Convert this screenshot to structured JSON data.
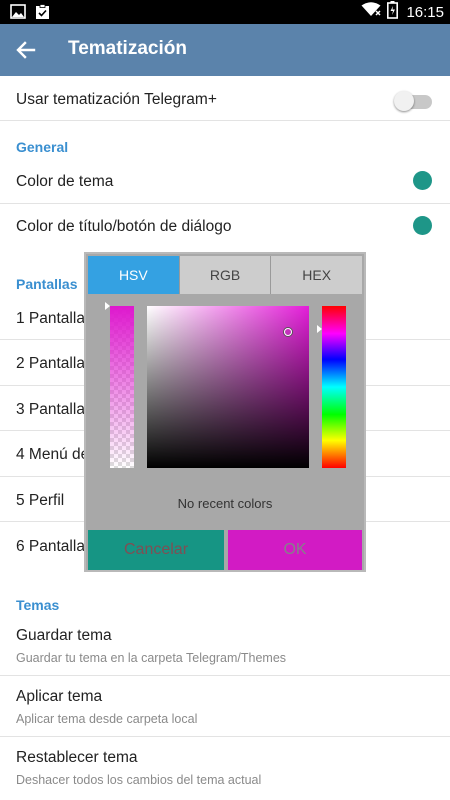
{
  "status_bar": {
    "time": "16:15",
    "icons": [
      "image-icon",
      "clipboard-check-icon",
      "wifi-icon",
      "battery-icon"
    ]
  },
  "app_bar": {
    "title": "Tematización",
    "back_icon": "arrow-left-icon"
  },
  "main": {
    "toggle_row": {
      "label": "Usar tematización Telegram+",
      "enabled": false
    },
    "general": {
      "header": "General",
      "items": [
        {
          "label": "Color de tema",
          "swatch": "#1e9688"
        },
        {
          "label": "Color de título/botón de diálogo",
          "swatch": "#1e9688"
        }
      ]
    },
    "pantallas": {
      "header": "Pantallas",
      "items": [
        {
          "label": "1 Pantalla"
        },
        {
          "label": "2 Pantalla"
        },
        {
          "label": "3 Pantalla"
        },
        {
          "label": "4 Menú de"
        },
        {
          "label": "5 Perfil"
        },
        {
          "label": "6 Pantalla"
        }
      ]
    },
    "temas": {
      "header": "Temas",
      "items": [
        {
          "title": "Guardar tema",
          "subtitle": "Guardar tu tema en la carpeta Telegram/Themes"
        },
        {
          "title": "Aplicar tema",
          "subtitle": "Aplicar tema desde carpeta local"
        },
        {
          "title": "Restablecer tema",
          "subtitle": "Deshacer todos los cambios del tema actual"
        }
      ]
    }
  },
  "color_dialog": {
    "tabs": [
      {
        "label": "HSV",
        "active": true
      },
      {
        "label": "RGB",
        "active": false
      },
      {
        "label": "HEX",
        "active": false
      }
    ],
    "selected_color": "#d21bc4",
    "hue_color": "#e41ed9",
    "recent_text": "No recent colors",
    "cancel_label": "Cancelar",
    "ok_label": "OK",
    "colors": {
      "cancel_bg": "#169584",
      "ok_bg": "#d21bc4",
      "tab_active": "#34a1e2"
    }
  }
}
